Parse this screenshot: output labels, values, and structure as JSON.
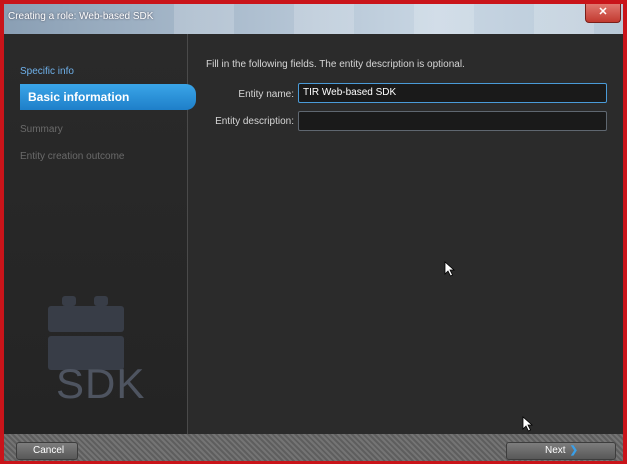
{
  "window": {
    "title": "Creating a role: Web-based SDK",
    "close_icon": "close-icon"
  },
  "sidebar": {
    "steps": [
      {
        "label": "Specific info",
        "state": "done"
      },
      {
        "label": "Basic information",
        "state": "active"
      },
      {
        "label": "Summary",
        "state": "pending"
      },
      {
        "label": "Entity creation outcome",
        "state": "pending"
      }
    ],
    "logo_text": "SDK"
  },
  "main": {
    "instructions": "Fill in the following fields. The entity description is optional.",
    "entity_name_label": "Entity name:",
    "entity_name_value": "TIR Web-based SDK",
    "entity_description_label": "Entity description:",
    "entity_description_value": ""
  },
  "footer": {
    "cancel_label": "Cancel",
    "next_label": "Next"
  },
  "colors": {
    "accent": "#2b93dd",
    "frame": "#c9141a",
    "background": "#2b2b2b"
  }
}
